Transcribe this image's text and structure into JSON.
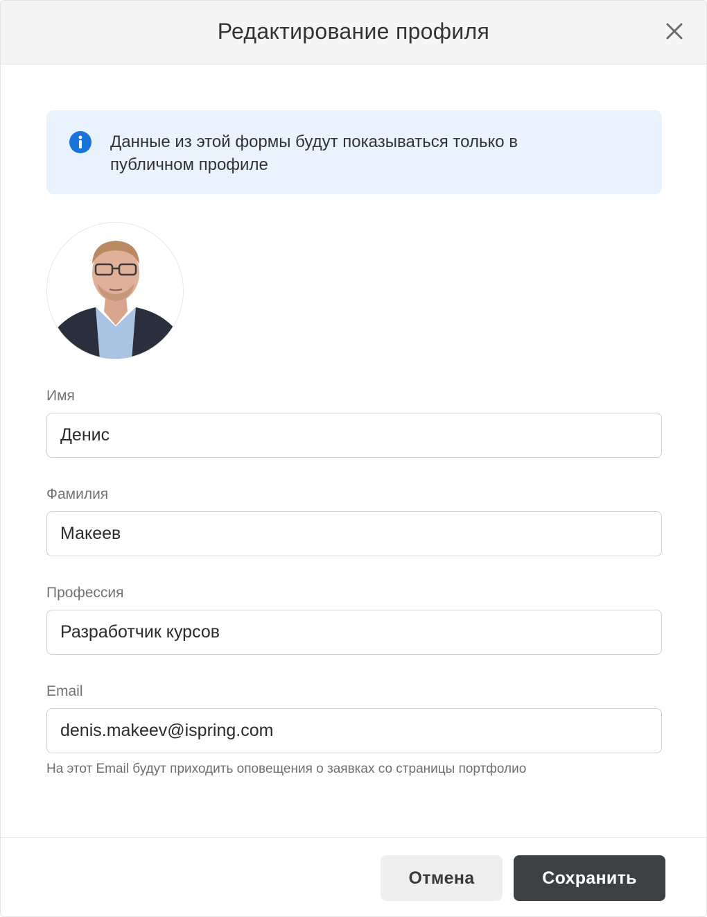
{
  "dialog": {
    "title": "Редактирование профиля"
  },
  "info": {
    "icon": "info-icon",
    "text_line1": "Данные из этой формы будут показываться только в",
    "text_line2": "публичном профиле"
  },
  "avatar": {
    "alt": "Фото профиля"
  },
  "fields": {
    "first_name": {
      "label": "Имя",
      "value": "Денис"
    },
    "last_name": {
      "label": "Фамилия",
      "value": "Макеев"
    },
    "profession": {
      "label": "Профессия",
      "value": "Разработчик курсов"
    },
    "email": {
      "label": "Email",
      "value": "denis.makeev@ispring.com",
      "hint": "На этот Email будут приходить оповещения о заявках со страницы портфолио"
    }
  },
  "footer": {
    "cancel_label": "Отмена",
    "save_label": "Сохранить"
  },
  "colors": {
    "accent_info": "#1a73d9",
    "info_bg": "#e9f3fd",
    "primary_button": "#3d4144"
  }
}
